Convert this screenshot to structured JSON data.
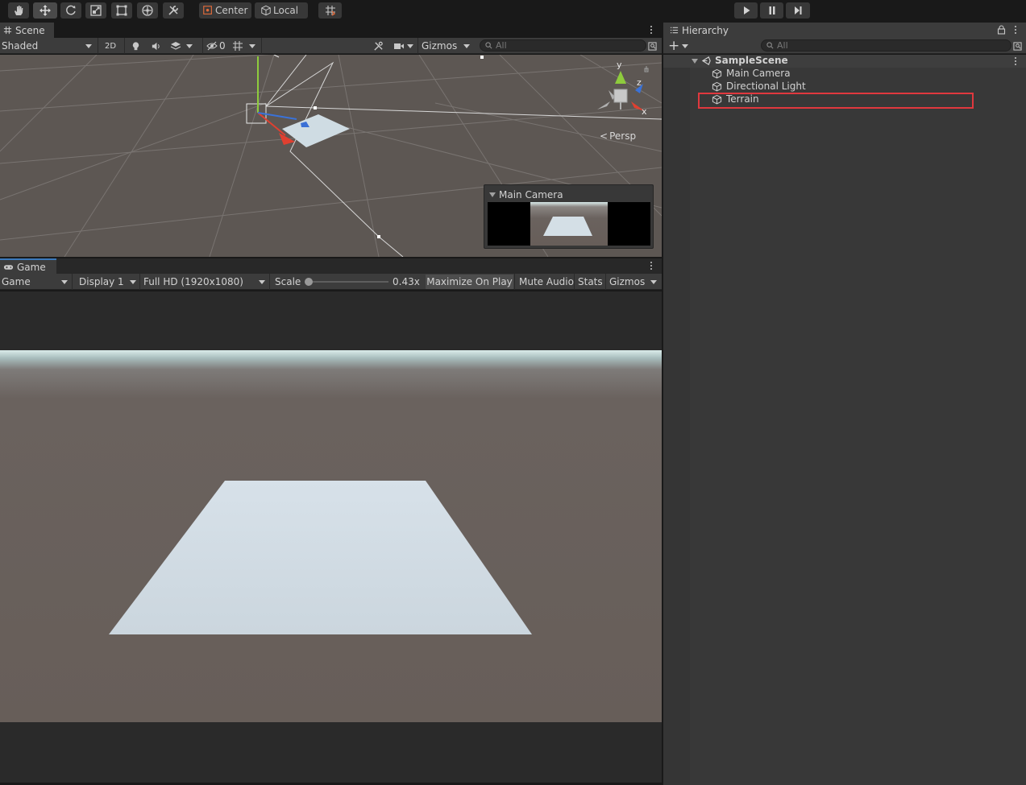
{
  "toolbar": {
    "tools": [
      "hand-tool",
      "move-tool",
      "rotate-tool",
      "scale-tool",
      "rect-tool",
      "transform-tool",
      "custom-tool"
    ],
    "pivot_label": "Center",
    "space_label": "Local",
    "playback": [
      "play",
      "pause",
      "step"
    ]
  },
  "scene": {
    "tab_label": "Scene",
    "shading_mode": "Shaded",
    "mode_2d": "2D",
    "hidden_count": "0",
    "gizmos_label": "Gizmos",
    "search_placeholder": "All",
    "persp_label": "Persp",
    "axis_labels": {
      "x": "x",
      "y": "y",
      "z": "z"
    },
    "camera_preview_title": "Main Camera"
  },
  "game": {
    "tab_label": "Game",
    "view_mode": "Game",
    "display": "Display 1",
    "resolution": "Full HD (1920x1080)",
    "scale_label": "Scale",
    "scale_value": "0.43x",
    "scale_fraction": 0.0,
    "maximize_label": "Maximize On Play",
    "mute_label": "Mute Audio",
    "stats_label": "Stats",
    "gizmos_label": "Gizmos"
  },
  "hierarchy": {
    "tab_label": "Hierarchy",
    "search_placeholder": "All",
    "scene_name": "SampleScene",
    "items": [
      {
        "label": "Main Camera",
        "highlighted": false
      },
      {
        "label": "Directional Light",
        "highlighted": false
      },
      {
        "label": "Terrain",
        "highlighted": true
      }
    ]
  },
  "colors": {
    "highlight_border": "#e0383e",
    "accent_tab": "#3a79bb",
    "axis_x": "#e04030",
    "axis_y": "#8ecb3d",
    "axis_z": "#3a72d8"
  }
}
